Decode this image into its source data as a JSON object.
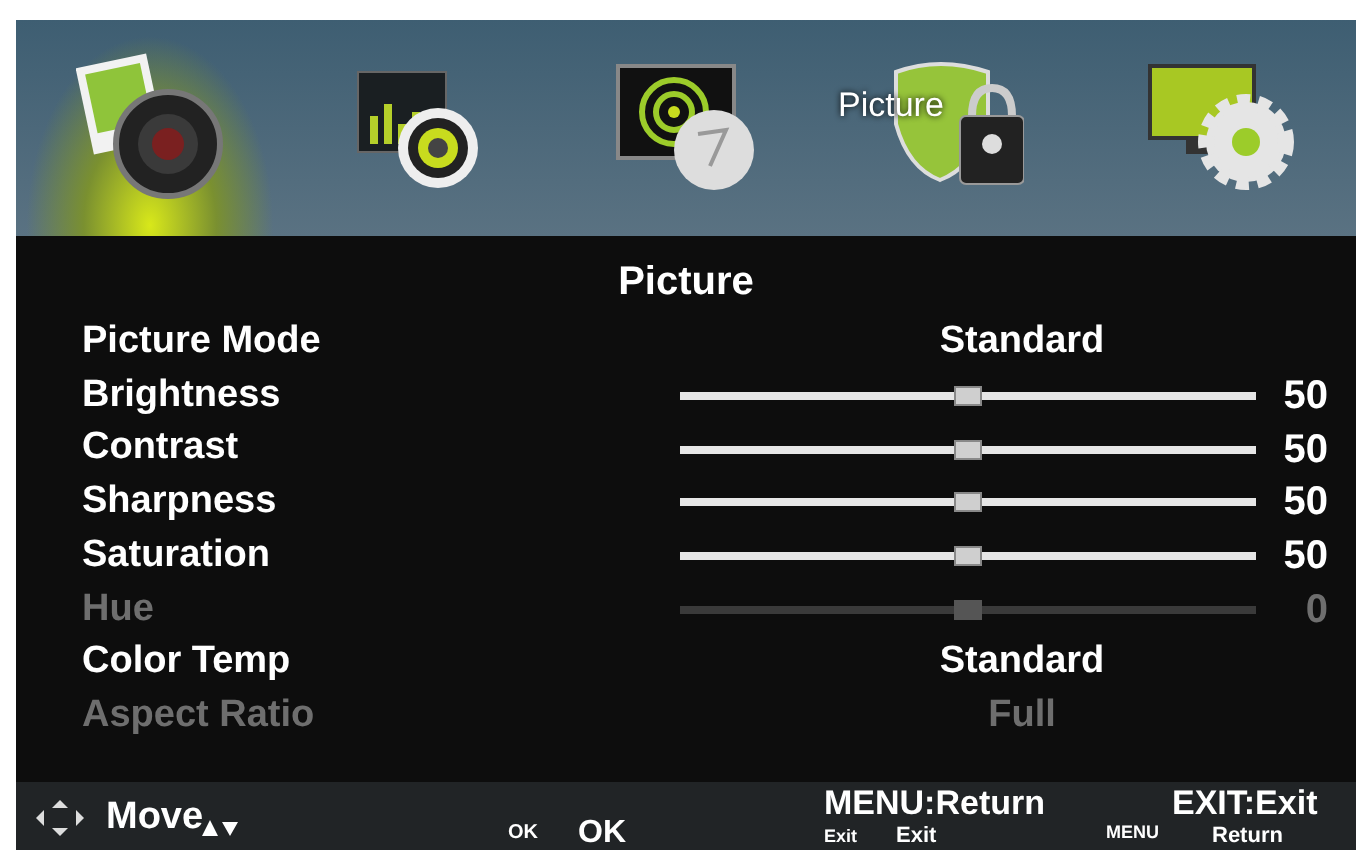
{
  "top_menu": {
    "items": [
      {
        "kind": "picture",
        "selected": true
      },
      {
        "kind": "sound",
        "selected": false
      },
      {
        "kind": "channel",
        "selected": false
      },
      {
        "kind": "lock",
        "selected": false,
        "label": "Picture"
      },
      {
        "kind": "setup",
        "selected": false
      }
    ]
  },
  "title": "Picture",
  "rows": [
    {
      "kind": "option",
      "label": "Picture Mode",
      "value": "Standard",
      "disabled": false
    },
    {
      "kind": "slider",
      "label": "Brightness",
      "level": 0.5,
      "reading": "50",
      "disabled": false
    },
    {
      "kind": "slider",
      "label": "Contrast",
      "level": 0.5,
      "reading": "50",
      "disabled": false
    },
    {
      "kind": "slider",
      "label": "Sharpness",
      "level": 0.5,
      "reading": "50",
      "disabled": false
    },
    {
      "kind": "slider",
      "label": "Saturation",
      "level": 0.5,
      "reading": "50",
      "disabled": false
    },
    {
      "kind": "slider",
      "label": "Hue",
      "level": 0.5,
      "reading": "0",
      "disabled": true
    },
    {
      "kind": "option",
      "label": "Color Temp",
      "value": "Standard",
      "disabled": false
    },
    {
      "kind": "option",
      "label": "Aspect Ratio",
      "value": "Full",
      "disabled": true
    }
  ],
  "footer": {
    "move": "Move",
    "ok_key": "OK",
    "ok": "OK",
    "menu_return": "MENU:Return",
    "exit_key": "Exit",
    "exit": "Exit",
    "menu_key": "MENU",
    "exit_exit": "EXIT:Exit",
    "return": "Return"
  }
}
